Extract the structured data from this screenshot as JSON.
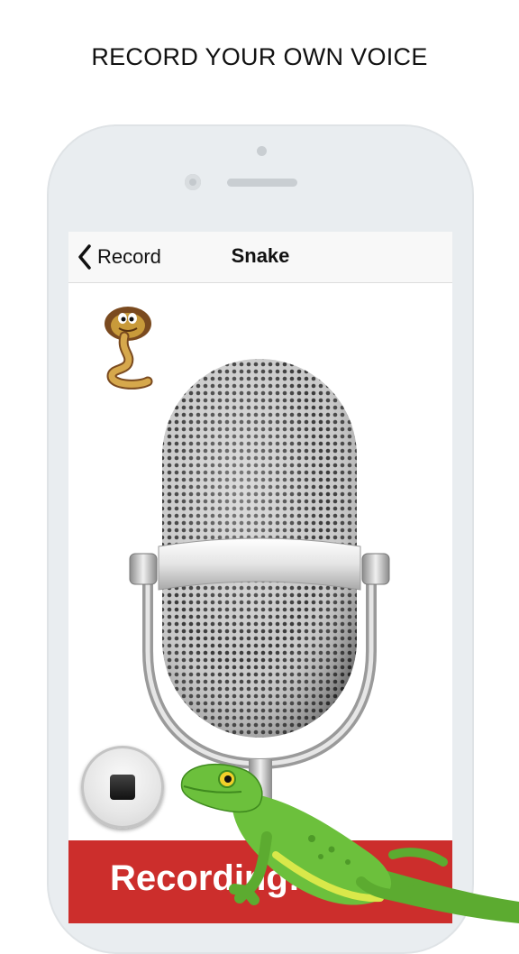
{
  "headline": "RECORD YOUR OWN VOICE",
  "nav": {
    "back_label": "Record",
    "title": "Snake"
  },
  "recording_status": "Recording: 0",
  "colors": {
    "recording_bar": "#cc2e2c",
    "nav_background": "#f8f8f8",
    "lizard": "#6cc03c"
  },
  "icons": {
    "back": "chevron-left-icon",
    "stop": "stop-icon",
    "animal": "snake-icon",
    "microphone": "microphone-icon",
    "decoration": "lizard-icon"
  }
}
